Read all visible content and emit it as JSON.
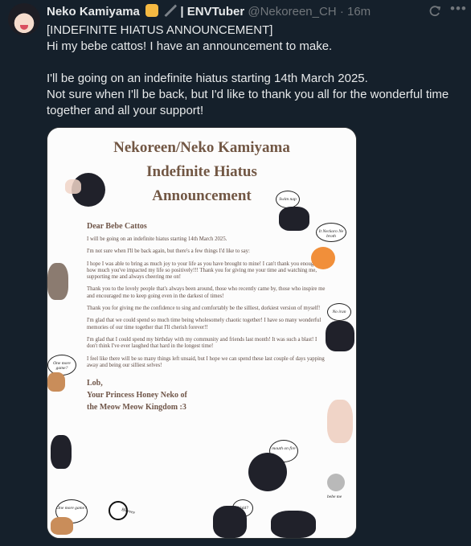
{
  "tweet": {
    "author_name": "Neko Kamiyama",
    "title_suffix": "| ENVTuber",
    "handle": "@Nekoreen_CH",
    "separator": "·",
    "time": "16m",
    "menu_icon": "more-icon",
    "retweet_icon": "refresh-icon",
    "lines": [
      "[INDEFINITE HIATUS ANNOUNCEMENT]",
      "Hi my bebe cattos! I have an announcement to make.",
      "",
      "I'll be going on an indefinite hiatus starting 14th March 2025.",
      "Not sure when I'll be back, but I'd like to thank you all for the wonderful time",
      "together and all your support!"
    ]
  },
  "poster": {
    "title_line1": "Nekoreen/Neko Kamiyama",
    "title_line2": "Indefinite Hiatus",
    "title_line3": "Announcement",
    "greeting": "Dear Bebe Cattos",
    "paragraphs": [
      "I will be going on an indefinite hiatus starting 14th March 2025.",
      "I'm not sure when I'll be back again, but there's a few things I'd like to say:",
      "I hope I was able to bring as much joy to your life as you have brought to mine! I can't thank you enough for how much you've impacted my life so positively!!! Thank you for giving me your time and watching me, supporting me and always cheering me on!",
      "Thank you to the lovely people that's always been around, those who recently came by, those who inspire me and encouraged me to keep going even in the darkest of times!",
      "Thank you for giving me the confidence to sing and comfortably be the silliest, dorkiest version of myself!",
      "I'm glad that we could spend so much time being wholesomely chaotic together! I have so many wonderful memories of our time together that I'll cherish forever!!",
      "I'm glad that I could spend my birthday with my community and friends last month! It was such a blast! I don't think I've ever laughed that hard in the longest time!",
      "I feel like there will be so many things left unsaid, but I hope we can spend these last couple of days yapping away and being our silliest selves!"
    ],
    "closing_1": "Lob,",
    "closing_2": "Your Princess Honey Neko of",
    "closing_3": "the Meow Meow Kingdom :3",
    "bubbles": [
      "Swim nap",
      "It Neckoro Ne broth",
      "No iran",
      "One more game?",
      "mouth on fire",
      "One more game?",
      "Wuld?",
      "Bleeeee",
      "bebe me"
    ]
  }
}
